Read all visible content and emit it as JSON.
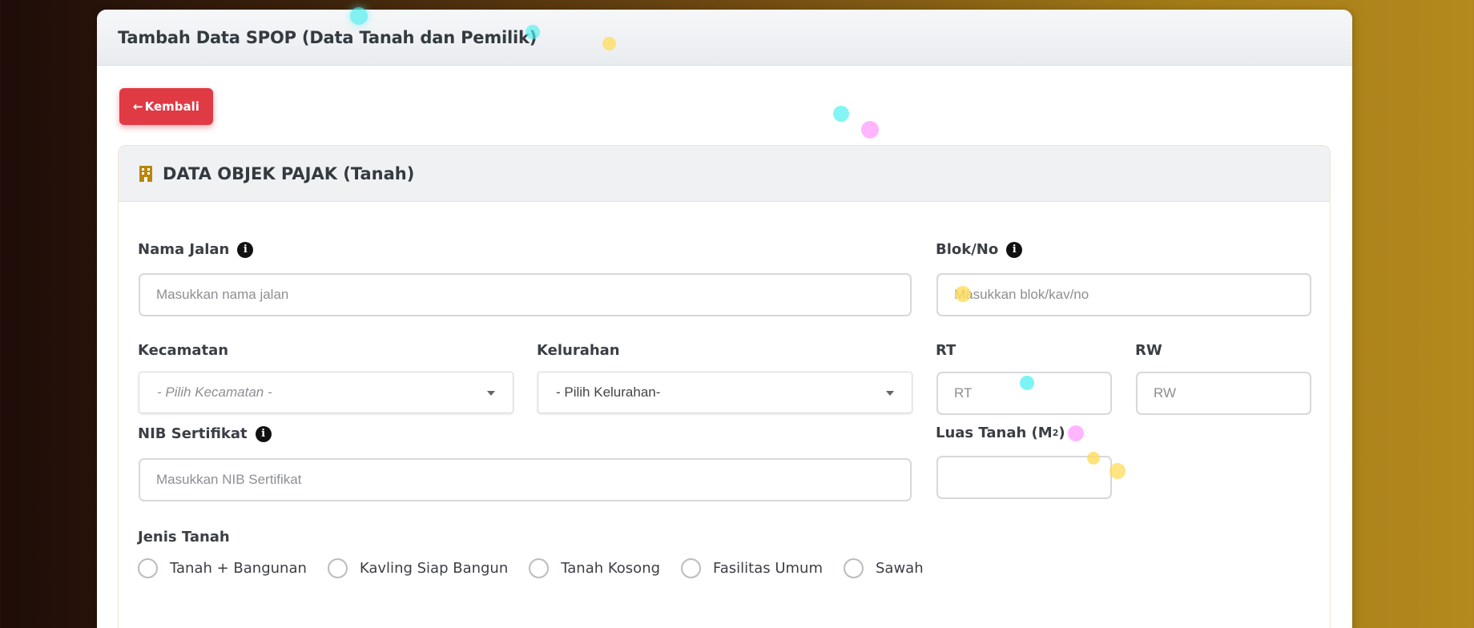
{
  "page": {
    "title": "Tambah Data SPOP (Data Tanah dan Pemilik)",
    "back_label": "Kembali",
    "back_icon": "arrow-left-icon"
  },
  "section": {
    "title": "DATA OBJEK PAJAK (Tanah)",
    "icon": "building-icon",
    "accent_color": "#b8860b"
  },
  "form": {
    "nama_jalan": {
      "label": "Nama Jalan",
      "placeholder": "Masukkan nama jalan",
      "value": ""
    },
    "blok_no": {
      "label": "Blok/No",
      "placeholder": "Masukkan blok/kav/no",
      "value": ""
    },
    "kecamatan": {
      "label": "Kecamatan",
      "selected": "- Pilih Kecamatan -"
    },
    "kelurahan": {
      "label": "Kelurahan",
      "selected": "- Pilih Kelurahan-"
    },
    "rt": {
      "label": "RT",
      "placeholder": "RT",
      "value": ""
    },
    "rw": {
      "label": "RW",
      "placeholder": "RW",
      "value": ""
    },
    "nib": {
      "label": "NIB Sertifikat",
      "placeholder": "Masukkan NIB Sertifikat",
      "value": ""
    },
    "luas_tanah": {
      "label_main": "Luas Tanah (M",
      "label_sup": "2",
      "label_end": ")",
      "value": ""
    },
    "jenis_tanah": {
      "label": "Jenis Tanah",
      "options": [
        "Tanah + Bangunan",
        "Kavling Siap Bangun",
        "Tanah Kosong",
        "Fasilitas Umum",
        "Sawah"
      ]
    }
  },
  "info_icon_glyph": "i",
  "colors": {
    "danger": "#e03a45",
    "text": "#3b3f45"
  }
}
